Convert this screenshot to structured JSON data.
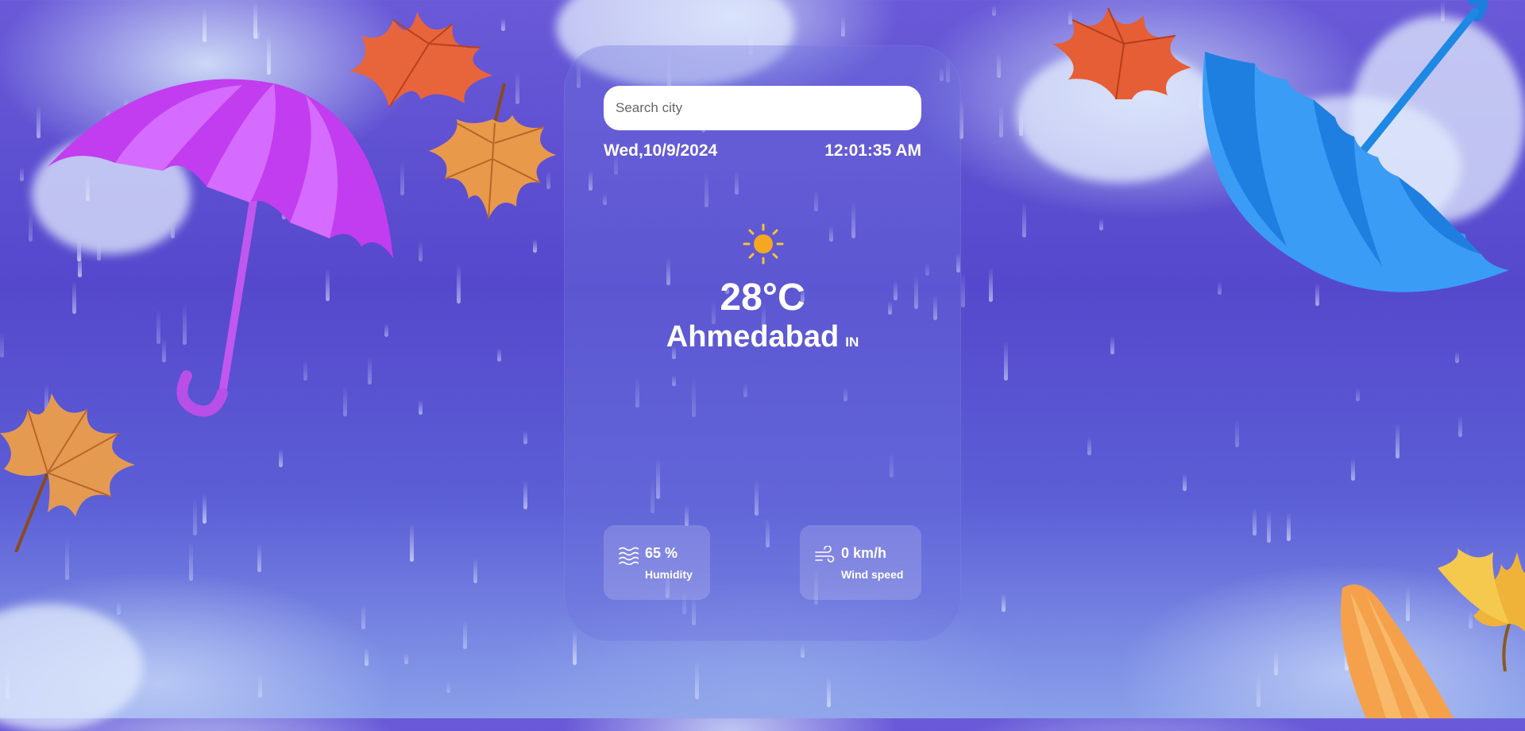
{
  "search": {
    "placeholder": "Search city",
    "value": ""
  },
  "datetime": {
    "date": "Wed,10/9/2024",
    "time": "12:01:35 AM"
  },
  "weather": {
    "icon": "sun-icon",
    "temperature": "28°C",
    "city": "Ahmedabad",
    "country": "IN"
  },
  "stats": {
    "humidity": {
      "value": "65 %",
      "label": "Humidity",
      "icon": "humidity-waves-icon"
    },
    "wind": {
      "value": "0 km/h",
      "label": "Wind speed",
      "icon": "wind-icon"
    }
  },
  "colors": {
    "sun": "#f5a623",
    "card": "#6e73dc",
    "background": "#5548cc"
  }
}
